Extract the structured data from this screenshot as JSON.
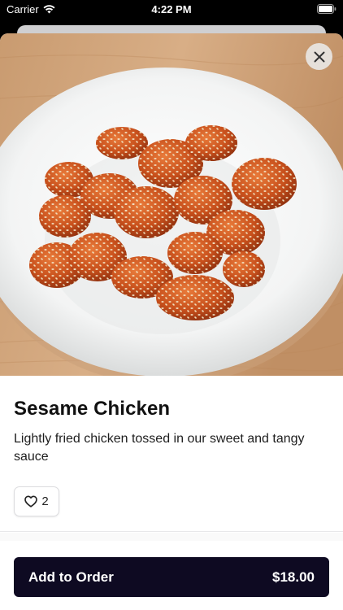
{
  "status_bar": {
    "carrier": "Carrier",
    "time": "4:22 PM"
  },
  "item": {
    "name": "Sesame Chicken",
    "description": "Lightly fried chicken tossed in our sweet and tangy sauce",
    "like_count": "2"
  },
  "cta": {
    "label": "Add to Order",
    "price": "$18.00"
  },
  "colors": {
    "cta_bg": "#0e0a22",
    "sauce": "#c8501c",
    "table_wood": "#c89a70"
  }
}
